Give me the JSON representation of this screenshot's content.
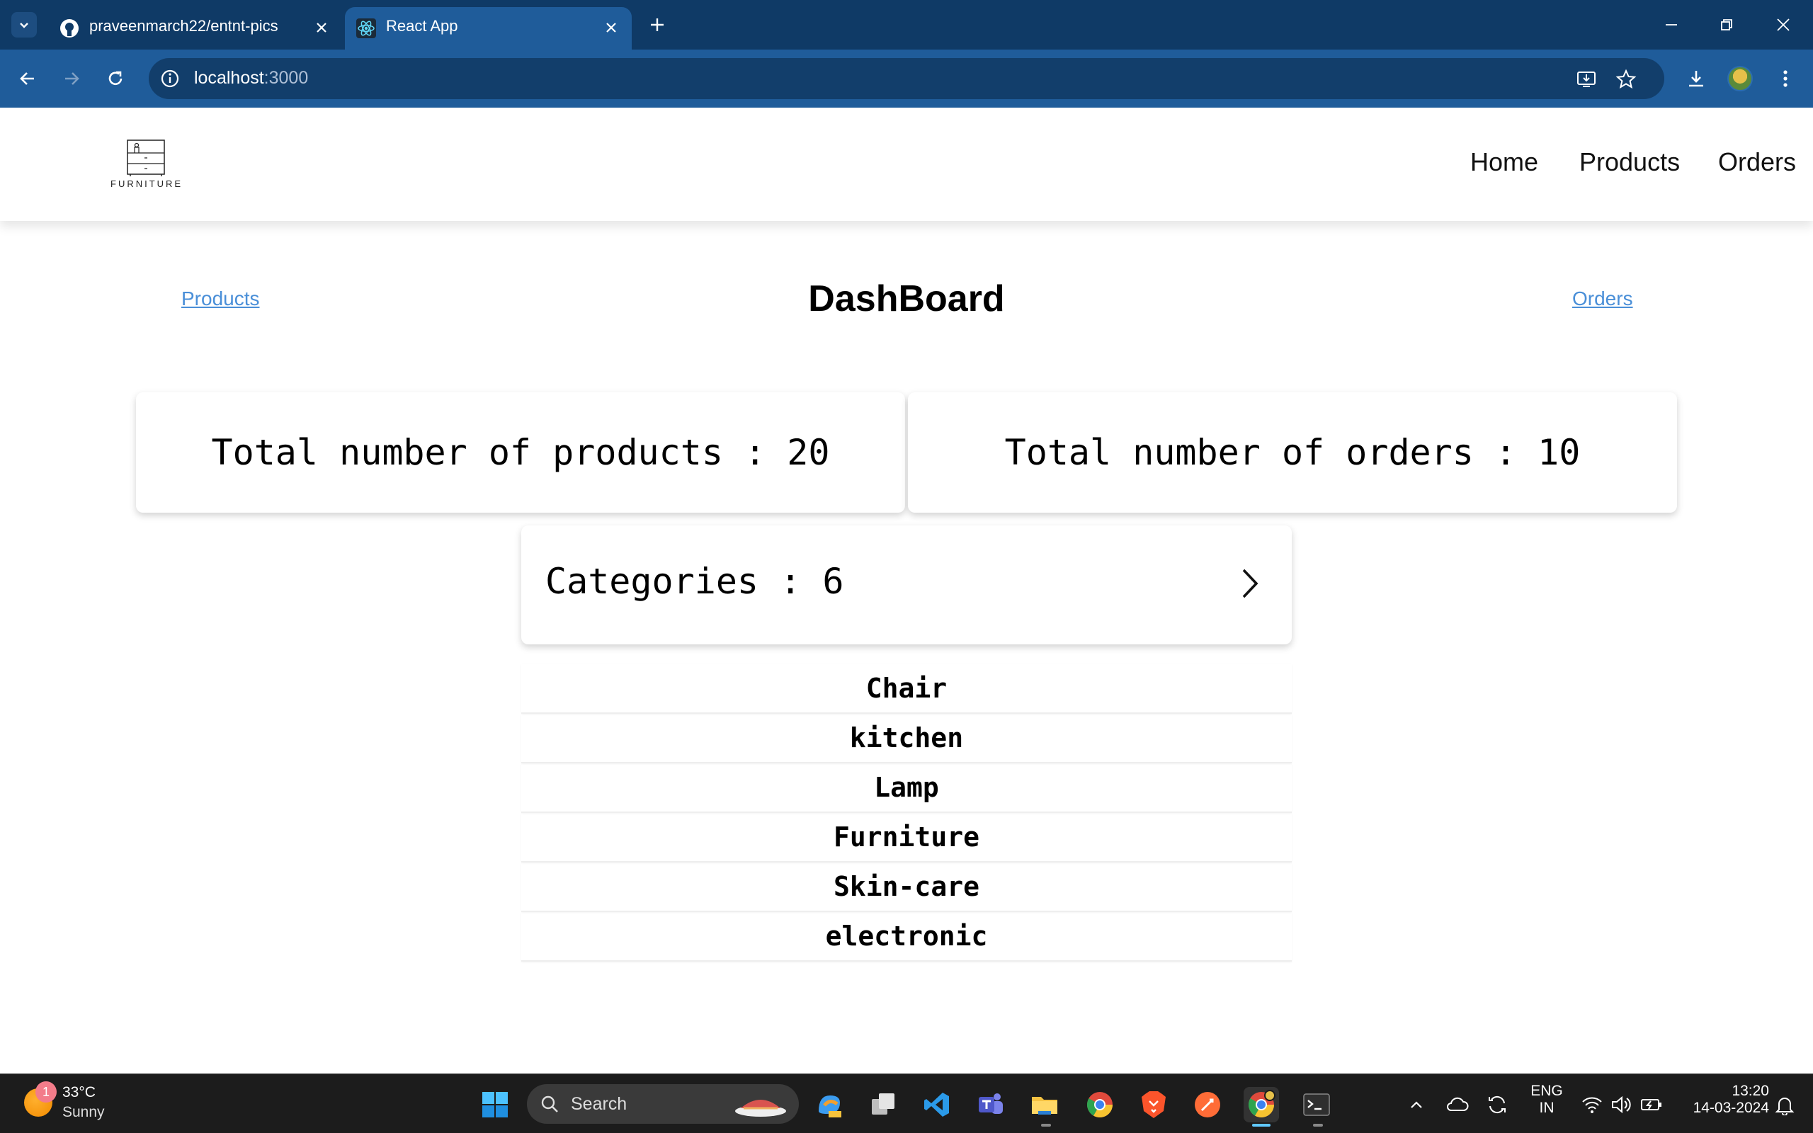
{
  "browser": {
    "tabs": [
      {
        "title": "praveenmarch22/entnt-pics",
        "favicon": "github-icon"
      },
      {
        "title": "React App",
        "favicon": "react-icon",
        "active": true
      }
    ],
    "url_host": "localhost",
    "url_port": ":3000"
  },
  "site": {
    "logo_text": "FURNITURE",
    "nav": {
      "home": "Home",
      "products": "Products",
      "orders": "Orders"
    }
  },
  "dashboard": {
    "title": "DashBoard",
    "left_link": "Products",
    "right_link": "Orders",
    "products_stat": "Total number of products : 20",
    "orders_stat": "Total number of orders : 10",
    "categories_label": "Categories : 6",
    "categories": [
      "Chair",
      "kitchen",
      "Lamp",
      "Furniture",
      "Skin-care",
      "electronic"
    ]
  },
  "taskbar": {
    "weather_temp": "33°C",
    "weather_desc": "Sunny",
    "weather_badge": "1",
    "search_label": "Search",
    "lang_top": "ENG",
    "lang_bottom": "IN",
    "time": "13:20",
    "date": "14-03-2024"
  },
  "colors": {
    "tabbar": "#0f3a66",
    "toolbar": "#1f5c9a",
    "link": "#4a8fd8"
  }
}
